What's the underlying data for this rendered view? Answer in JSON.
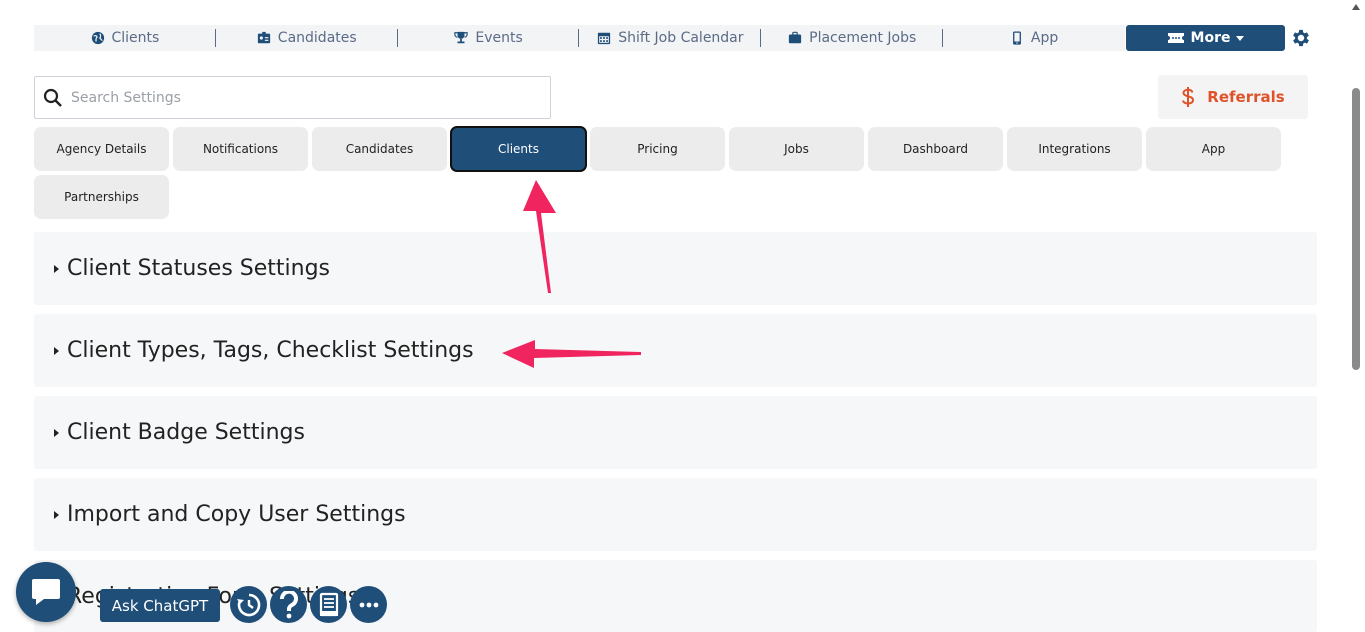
{
  "topnav": {
    "items": [
      {
        "label": "Clients",
        "icon": "globe-icon"
      },
      {
        "label": "Candidates",
        "icon": "id-card-icon"
      },
      {
        "label": "Events",
        "icon": "trophy-icon"
      },
      {
        "label": "Shift Job Calendar",
        "icon": "calendar-icon"
      },
      {
        "label": "Placement Jobs",
        "icon": "briefcase-icon"
      },
      {
        "label": "App",
        "icon": "mobile-icon"
      }
    ],
    "more_label": "More",
    "more_icon": "ticket-icon"
  },
  "search": {
    "placeholder": "Search Settings"
  },
  "referrals": {
    "label": "Referrals",
    "icon": "dollar-icon",
    "color": "#e0532a"
  },
  "tabs": [
    {
      "label": "Agency Details"
    },
    {
      "label": "Notifications"
    },
    {
      "label": "Candidates"
    },
    {
      "label": "Clients",
      "active": true
    },
    {
      "label": "Pricing"
    },
    {
      "label": "Jobs"
    },
    {
      "label": "Dashboard"
    },
    {
      "label": "Integrations"
    },
    {
      "label": "App"
    },
    {
      "label": "Partnerships"
    }
  ],
  "sections": [
    {
      "title": "Client Statuses Settings"
    },
    {
      "title": "Client Types, Tags, Checklist Settings"
    },
    {
      "title": "Client Badge Settings"
    },
    {
      "title": "Import and Copy User Settings"
    },
    {
      "title": "Registration Form Settings"
    }
  ],
  "bottom": {
    "ask_label": "Ask ChatGPT",
    "buttons": [
      "history-icon",
      "help-icon",
      "document-icon",
      "more-dots-icon"
    ]
  },
  "colors": {
    "primary": "#1f4e79",
    "accent_arrow": "#f0245f"
  }
}
